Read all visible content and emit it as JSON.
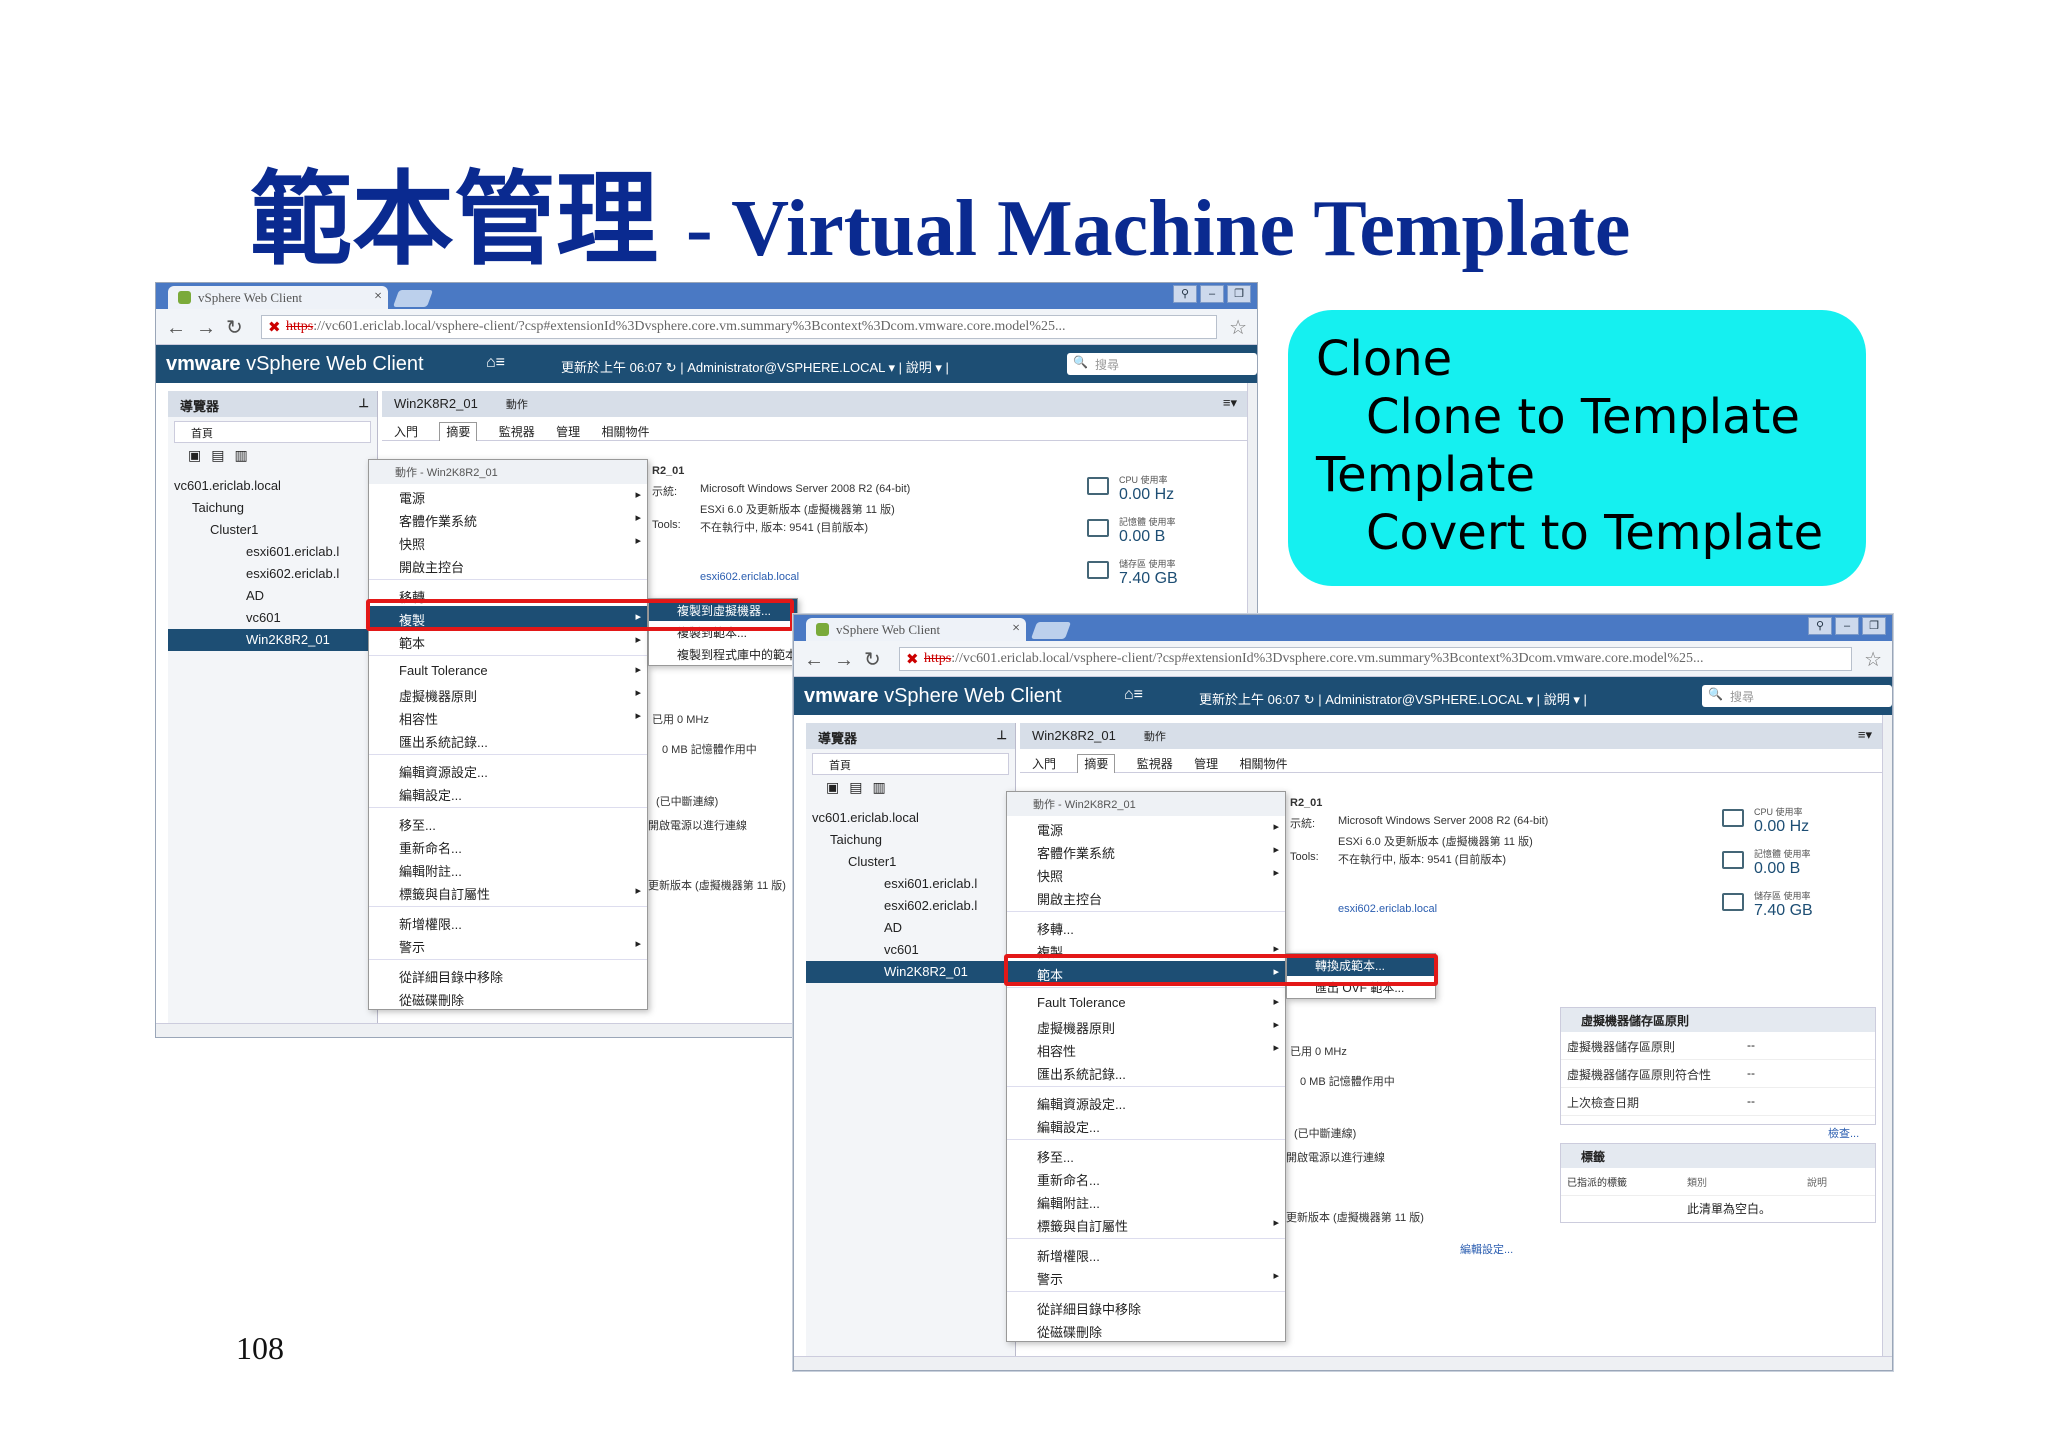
{
  "slide": {
    "title_zh": "範本管理",
    "title_en": "- Virtual Machine Template",
    "page_number": "108"
  },
  "note_box": {
    "lines": [
      "Clone",
      "Clone to Template",
      "Template",
      "Covert to Template"
    ]
  },
  "browser": {
    "tab_title": "vSphere Web Client",
    "url_https": "https",
    "url_rest": "://vc601.ericlab.local/vsphere-client/?csp#extensionId%3Dvsphere.core.vm.summary%3Bcontext%3Dcom.vmware.core.model%25..."
  },
  "vsphere": {
    "logo": "vmware",
    "product": "vSphere Web Client",
    "updated": "更新於上午 06:07",
    "user": "Administrator@VSPHERE.LOCAL",
    "help": "說明",
    "search_placeholder": "搜尋"
  },
  "navigator": {
    "title": "導覽器",
    "home": "首頁",
    "tree": [
      "vc601.ericlab.local",
      "Taichung",
      "Cluster1",
      "esxi601.ericlab.l",
      "esxi602.ericlab.l",
      "AD",
      "vc601",
      "Win2K8R2_01"
    ]
  },
  "main": {
    "vm_name": "Win2K8R2_01",
    "actions": "動作",
    "tabs": [
      "入門",
      "摘要",
      "監視器",
      "管理",
      "相關物件"
    ],
    "summary": {
      "name": "R2_01",
      "os_label": "示統:",
      "os": "Microsoft Windows Server 2008 R2 (64-bit)",
      "compat": "ESXi 6.0 及更新版本 (虛擬機器第 11 版)",
      "tools_label": "Tools:",
      "tools": "不在執行中, 版本: 9541 (目前版本)",
      "host": "esxi602.ericlab.local",
      "cpu_label": "CPU 使用率",
      "cpu": "0.00 Hz",
      "mem_label": "記憶體 使用率",
      "mem": "0.00 B",
      "storage_label": "儲存區 使用率",
      "storage": "7.40 GB",
      "cpu_used": "已用 0 MHz",
      "mem_used": "0 MB 記憶體作用中",
      "disconnected": "(已中斷連線)",
      "connect": "開啟電源以進行連線",
      "upgrade": "更新版本 (虛擬機器第 11 版)",
      "edit": "編輯設定..."
    },
    "policy_panel": {
      "title": "虛擬機器儲存區原則",
      "rows": [
        [
          "虛擬機器儲存區原則",
          "--"
        ],
        [
          "虛擬機器儲存區原則符合性",
          "--"
        ],
        [
          "上次檢查日期",
          "--"
        ]
      ],
      "check": "檢查..."
    },
    "tags_panel": {
      "title": "標籤",
      "cols": [
        "已指派的標籤",
        "類別",
        "說明"
      ],
      "empty": "此清單為空白。"
    }
  },
  "context_menu": {
    "header": "動作 - Win2K8R2_01",
    "items": [
      "電源",
      "客體作業系統",
      "快照",
      "開啟主控台",
      "移轉...",
      "複製",
      "範本",
      "Fault Tolerance",
      "虛擬機器原則",
      "相容性",
      "匯出系統記錄...",
      "編輯資源設定...",
      "編輯設定...",
      "移至...",
      "重新命名...",
      "編輯附註...",
      "標籤與自訂屬性",
      "新增權限...",
      "警示",
      "從詳細目錄中移除",
      "從磁碟刪除"
    ]
  },
  "submenu_clone": [
    "複製到虛擬機器...",
    "複製到範本...",
    "複製到程式庫中的範本..."
  ],
  "submenu_template": [
    "轉換成範本...",
    "匯出 OVF 範本..."
  ],
  "colors": {
    "title_blue": "#0a2a90",
    "note_cyan": "#15f0f0",
    "vsphere_bar": "#1d4e74",
    "highlight_red": "#e31818"
  }
}
